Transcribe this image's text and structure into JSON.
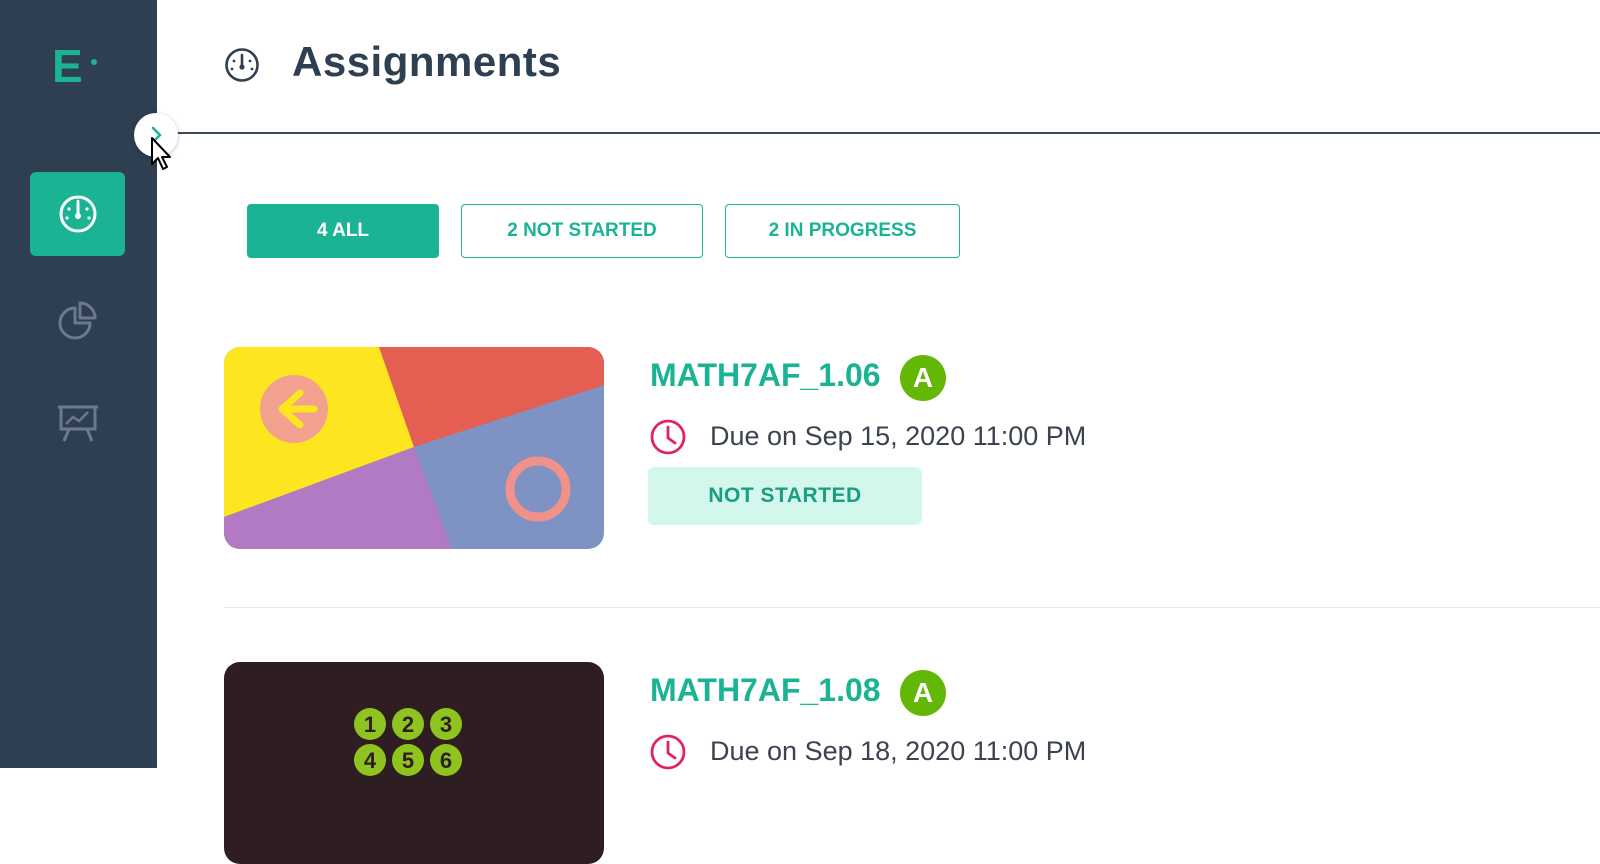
{
  "app": {
    "logo_letter": "E",
    "accent_color": "#1ab394",
    "sidebar_color": "#2f3f52"
  },
  "sidebar": {
    "items": [
      {
        "name": "dashboard",
        "icon": "speedometer-icon",
        "active": true
      },
      {
        "name": "reports",
        "icon": "pie-chart-icon",
        "active": false
      },
      {
        "name": "classes",
        "icon": "presentation-board-icon",
        "active": false
      }
    ],
    "toggle_icon": "chevron-right-icon"
  },
  "header": {
    "title": "Assignments",
    "icon": "speedometer-icon"
  },
  "filters": [
    {
      "label": "4 ALL",
      "active": true
    },
    {
      "label": "2 NOT STARTED",
      "active": false
    },
    {
      "label": "2 IN PROGRESS",
      "active": false
    }
  ],
  "assignments": [
    {
      "title": "MATH7AF_1.06",
      "grade": "A",
      "due": "Due on Sep 15, 2020 11:00 PM",
      "status": "NOT STARTED"
    },
    {
      "title": "MATH7AF_1.08",
      "grade": "A",
      "due": "Due on Sep 18, 2020 11:00 PM",
      "thumbnail_numbers": [
        "1",
        "2",
        "3",
        "4",
        "5",
        "6"
      ]
    }
  ]
}
